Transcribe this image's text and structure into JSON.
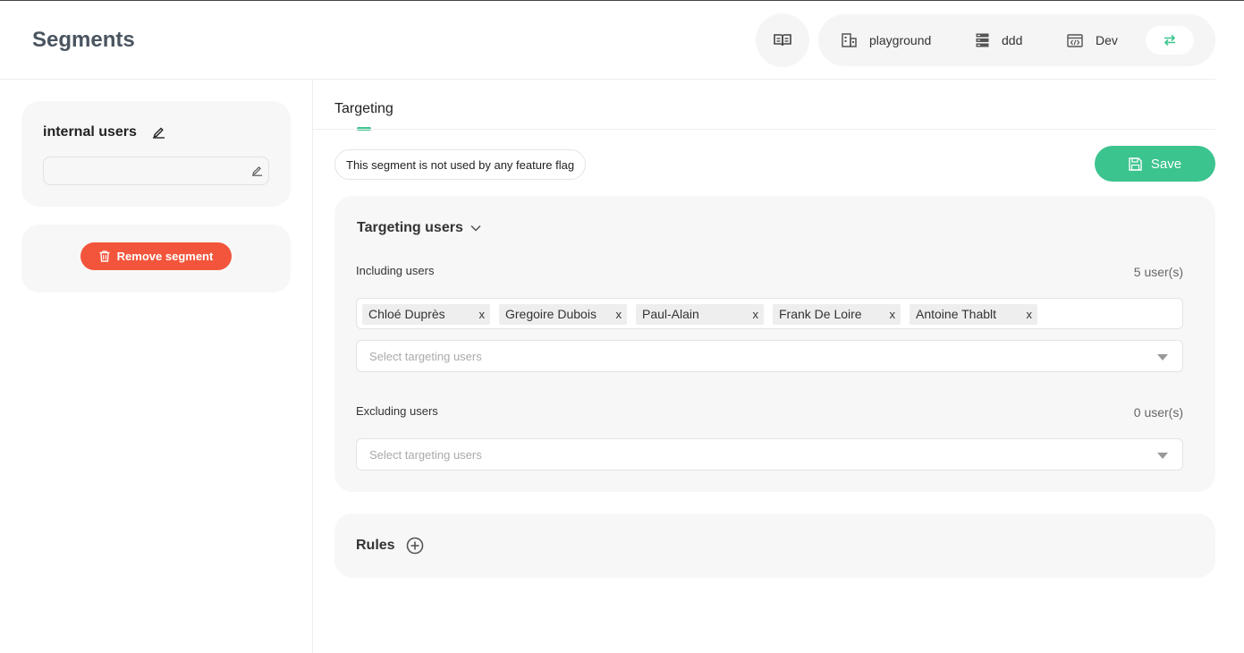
{
  "header": {
    "title": "Segments",
    "context": {
      "project": "playground",
      "environment_group": "ddd",
      "environment": "Dev"
    },
    "icons": {
      "docs": "book-open-icon",
      "project": "building-icon",
      "group": "server-icon",
      "environment": "code-window-icon",
      "switch": "swap-arrows-icon"
    },
    "accent_color": "#3cc48e"
  },
  "segment": {
    "name": "internal users",
    "description": "",
    "remove_label": "Remove segment",
    "remove_color": "#f2553b"
  },
  "tabs": [
    {
      "label": "Targeting",
      "active": true
    }
  ],
  "usage_text": "This segment is not used by any feature flag",
  "save_label": "Save",
  "targeting": {
    "title": "Targeting users",
    "including": {
      "label": "Including users",
      "count": "5 user(s)",
      "users": [
        "Chloé Duprès",
        "Gregoire Dubois",
        "Paul-Alain",
        "Frank De Loire",
        "Antoine Thablt"
      ],
      "placeholder": "Select targeting users"
    },
    "excluding": {
      "label": "Excluding users",
      "count": "0 user(s)",
      "users": [],
      "placeholder": "Select targeting users"
    }
  },
  "rules": {
    "title": "Rules"
  }
}
